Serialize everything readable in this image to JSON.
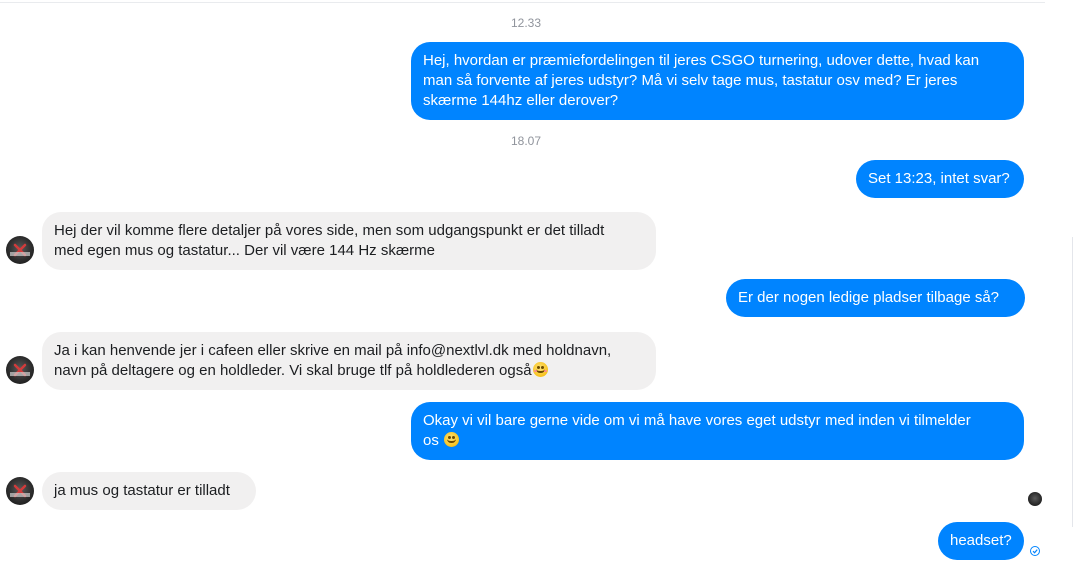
{
  "conversation": {
    "timestamps": [
      "12.33",
      "18.07"
    ],
    "messages": [
      {
        "from": "me",
        "lines": [
          "Hej, hvordan er præmiefordelingen til jeres CSGO turnering, udover dette, hvad kan",
          "man så forvente af jeres udstyr? Må vi selv tage mus, tastatur osv med? Er jeres",
          "skærme 144hz eller derover?"
        ]
      },
      {
        "from": "me",
        "lines": [
          "Set 13:23, intet svar?"
        ]
      },
      {
        "from": "them",
        "lines": [
          "Hej der vil komme flere detaljer på vores side, men som udgangspunkt er det tilladt",
          "med egen mus og tastatur... Der vil være 144 Hz skærme"
        ]
      },
      {
        "from": "me",
        "lines": [
          "Er der nogen ledige pladser tilbage så?"
        ]
      },
      {
        "from": "them",
        "lines": [
          "Ja i kan henvende jer i cafeen eller skrive en mail på info@nextlvl.dk med holdnavn,",
          "navn på deltagere og en holdleder. Vi skal bruge tlf på holdlederen også"
        ],
        "emoji": "smiling-blush-emoji"
      },
      {
        "from": "me",
        "lines": [
          "Okay vi vil bare gerne vide om vi må have vores eget udstyr med inden vi tilmelder",
          "os"
        ],
        "emoji": "smile-emoji"
      },
      {
        "from": "them",
        "lines": [
          "ja mus og tastatur er tilladt"
        ]
      },
      {
        "from": "me",
        "lines": [
          "headset?"
        ]
      }
    ]
  },
  "colors": {
    "outgoing_bubble": "#0084ff",
    "incoming_bubble": "#f1f0f0",
    "timestamp": "#90949c"
  },
  "icons": {
    "avatar": "nextlvl-logo-avatar",
    "read_receipt": "seen-avatar-icon",
    "sent_status": "sent-check-icon"
  }
}
